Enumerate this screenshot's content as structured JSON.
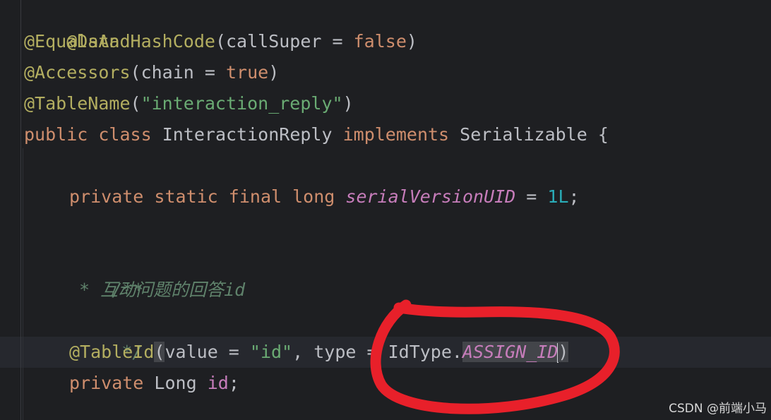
{
  "code": {
    "line1": {
      "ann": "@Data"
    },
    "line2": {
      "ann": "@EqualsAndHashCode",
      "open": "(",
      "param": "callSuper = ",
      "val": "false",
      "close": ")"
    },
    "line3": {
      "ann": "@Accessors",
      "open": "(",
      "param": "chain = ",
      "val": "true",
      "close": ")"
    },
    "line4": {
      "ann": "@TableName",
      "open": "(",
      "str": "\"interaction_reply\"",
      "close": ")"
    },
    "line5": {
      "kw1": "public",
      "kw2": "class",
      "name": "InteractionReply",
      "kw3": "implements",
      "iface": "Serializable {"
    },
    "line7": {
      "kw1": "private",
      "kw2": "static",
      "kw3": "final",
      "kw4": "long",
      "field": "serialVersionUID",
      "eq": " = ",
      "num": "1L",
      "semi": ";"
    },
    "line9": {
      "text": "/**"
    },
    "line10": {
      "star": "*",
      "text": "互动问题的回答id"
    },
    "line11": {
      "text": "*/"
    },
    "line12": {
      "ann": "@TableId",
      "open": "(",
      "p1": "value = ",
      "str": "\"id\"",
      "p2": ", type = IdType.",
      "const": "ASSIGN_ID",
      "close": ")"
    },
    "line13": {
      "kw1": "private",
      "type": "Long",
      "field": "id",
      "semi": ";"
    }
  },
  "watermark": "CSDN @前端小马",
  "colors": {
    "background": "#1e1f22",
    "annotation": "#b3ae60",
    "keyword": "#cf8e6d",
    "string": "#6aab73",
    "number": "#2aacb8",
    "field": "#c77dbb",
    "comment": "#5f826b",
    "marker": "#e8202a"
  }
}
